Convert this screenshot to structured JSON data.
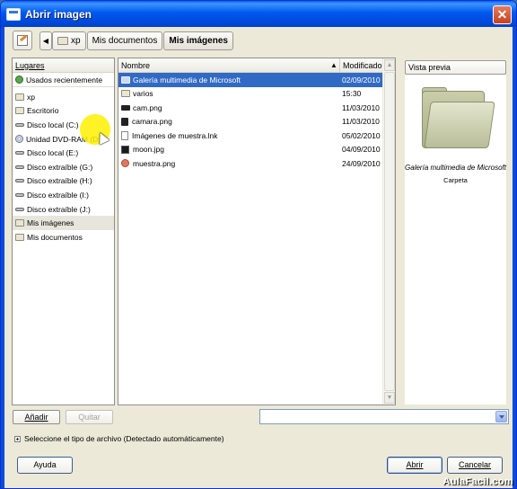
{
  "window": {
    "title": "Abrir imagen",
    "close_glyph": "✕"
  },
  "pathbar": {
    "edit_icon": "pencil-icon",
    "back_glyph": "◀",
    "segments": [
      {
        "label": "xp",
        "icon": "folder-icon"
      },
      {
        "label": "Mis documentos"
      },
      {
        "label": "Mis imágenes",
        "active": true
      }
    ]
  },
  "places": {
    "header": "Lugares",
    "recent": "Usados recientemente",
    "items": [
      {
        "label": "xp",
        "icon": "folder-icon"
      },
      {
        "label": "Escritorio",
        "icon": "folder-icon"
      },
      {
        "label": "Disco local (C:)",
        "icon": "drive-icon"
      },
      {
        "label": "Unidad DVD-RAM (D:)",
        "icon": "cd-icon"
      },
      {
        "label": "Disco local (E:)",
        "icon": "drive-icon"
      },
      {
        "label": "Disco extraíble (G:)",
        "icon": "drive-icon"
      },
      {
        "label": "Disco extraíble (H:)",
        "icon": "drive-icon"
      },
      {
        "label": "Disco extraíble (I:)",
        "icon": "drive-icon"
      },
      {
        "label": "Disco extraíble (J:)",
        "icon": "drive-icon"
      },
      {
        "label": "Mis imágenes",
        "icon": "folder-icon",
        "selected": true
      },
      {
        "label": "Mis documentos",
        "icon": "folder-icon"
      }
    ]
  },
  "files": {
    "col_name": "Nombre",
    "col_modified": "Modificado",
    "sort_glyph": "▲",
    "rows": [
      {
        "name": "Galería multimedia de Microsoft",
        "date": "02/09/2010",
        "icon": "folder-icon",
        "selected": true
      },
      {
        "name": "varios",
        "date": "15:30",
        "icon": "folder-icon"
      },
      {
        "name": "cam.png",
        "date": "11/03/2010",
        "icon": "camera-icon"
      },
      {
        "name": "camara.png",
        "date": "11/03/2010",
        "icon": "camera-icon"
      },
      {
        "name": "Imágenes de muestra.lnk",
        "date": "05/02/2010",
        "icon": "file-icon"
      },
      {
        "name": "moon.jpg",
        "date": "04/09/2010",
        "icon": "image-icon"
      },
      {
        "name": "muestra.png",
        "date": "24/09/2010",
        "icon": "image-icon"
      }
    ]
  },
  "preview": {
    "button_label": "Vista previa",
    "name": "Galería multimedia de Microsoft",
    "type": "Carpeta"
  },
  "controls": {
    "add_label": "Añadir",
    "remove_label": "Quitar",
    "filter_value": "",
    "expander_label": "Seleccione el tipo de archivo (Detectado automáticamente)",
    "help_label": "Ayuda",
    "open_label": "Abrir",
    "cancel_label": "Cancelar"
  },
  "watermark": "AulaFacil.com",
  "colors": {
    "title_bar": "#0058ee",
    "selection": "#316ac5",
    "dialog_bg": "#ece9d8"
  }
}
